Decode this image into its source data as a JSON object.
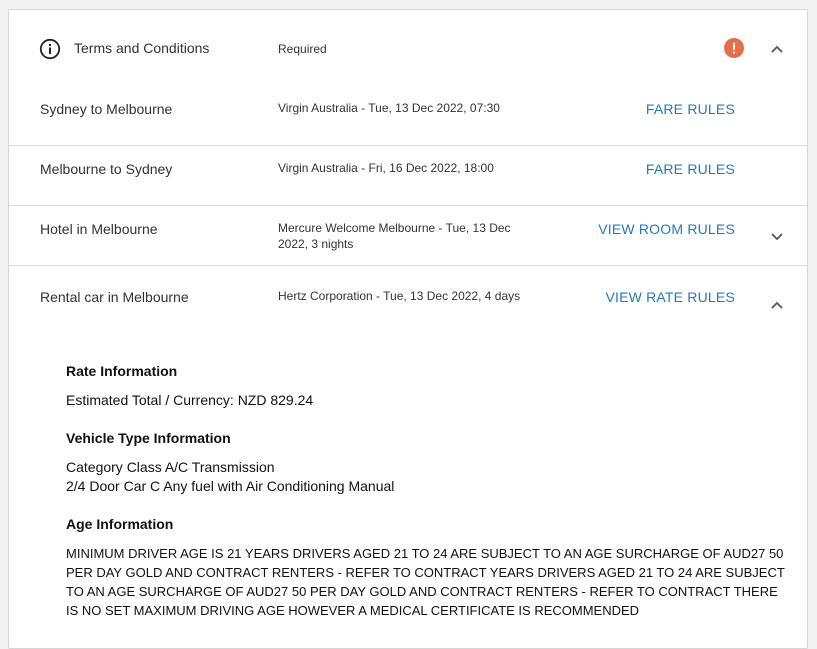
{
  "header": {
    "title": "Terms and Conditions",
    "status": "Required",
    "alert_color": "#e46f4d"
  },
  "rows": [
    {
      "label": "Sydney to Melbourne",
      "detail": "Virgin Australia - Tue, 13 Dec 2022, 07:30",
      "link": "FARE RULES"
    },
    {
      "label": "Melbourne to Sydney",
      "detail": "Virgin Australia - Fri, 16 Dec 2022, 18:00",
      "link": "FARE RULES"
    },
    {
      "label": "Hotel in Melbourne",
      "detail": "Mercure Welcome Melbourne - Tue, 13 Dec 2022, 3 nights",
      "link": "VIEW ROOM RULES"
    },
    {
      "label": "Rental car in Melbourne",
      "detail": "Hertz Corporation - Tue, 13 Dec 2022, 4 days",
      "link": "VIEW RATE RULES"
    }
  ],
  "rules": {
    "rate_heading": "Rate Information",
    "rate_text": "Estimated Total / Currency: NZD 829.24",
    "vehicle_heading": "Vehicle Type Information",
    "vehicle_line1": "Category Class A/C Transmission",
    "vehicle_line2": "2/4 Door Car C Any fuel with Air Conditioning Manual",
    "age_heading": "Age Information",
    "age_text": "MINIMUM DRIVER AGE IS 21 YEARS DRIVERS AGED 21 TO 24 ARE SUBJECT TO AN AGE SURCHARGE OF AUD27 50 PER DAY GOLD AND CONTRACT RENTERS - REFER TO CONTRACT YEARS DRIVERS AGED 21 TO 24 ARE SUBJECT TO AN AGE SURCHARGE OF AUD27 50 PER DAY GOLD AND CONTRACT RENTERS - REFER TO CONTRACT THERE IS NO SET MAXIMUM DRIVING AGE HOWEVER A MEDICAL CERTIFICATE IS RECOMMENDED"
  },
  "icons": {
    "info": "info-circle-icon",
    "alert": "exclamation-circle-icon",
    "chevron_up": "chevron-up-icon",
    "chevron_down": "chevron-down-icon"
  },
  "colors": {
    "link": "#1f7bc1",
    "text": "#333333",
    "divider": "#dcdcdc"
  }
}
